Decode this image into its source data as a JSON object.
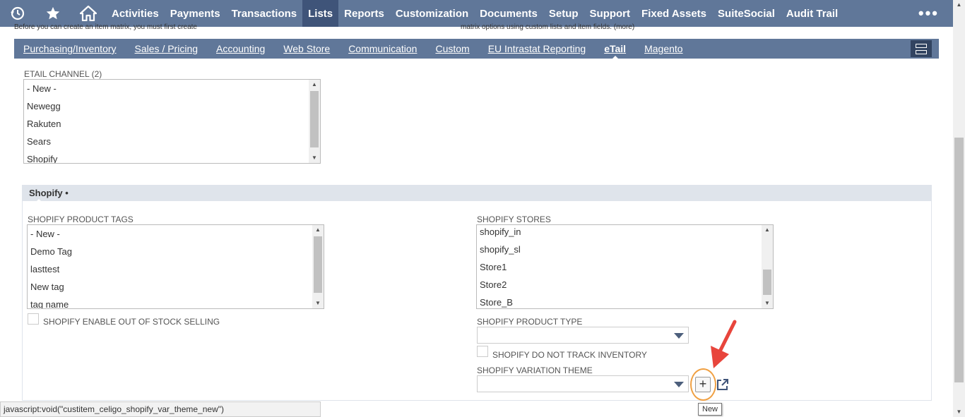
{
  "topnav": {
    "items": [
      {
        "label": "Activities"
      },
      {
        "label": "Payments"
      },
      {
        "label": "Transactions"
      },
      {
        "label": "Lists",
        "active": true
      },
      {
        "label": "Reports"
      },
      {
        "label": "Customization"
      },
      {
        "label": "Documents"
      },
      {
        "label": "Setup"
      },
      {
        "label": "Support"
      },
      {
        "label": "Fixed Assets"
      },
      {
        "label": "SuiteSocial"
      },
      {
        "label": "Audit Trail"
      }
    ],
    "more": "•••"
  },
  "cutoff": {
    "left": "Before you can create an item matrix, you must first create",
    "right": "matrix options using custom lists and item fields. (more)"
  },
  "subtabs": {
    "items": [
      {
        "label": "Purchasing/Inventory"
      },
      {
        "label": "Sales / Pricing"
      },
      {
        "label": "Accounting"
      },
      {
        "label": "Web Store"
      },
      {
        "label": "Communication"
      },
      {
        "label": "Custom"
      },
      {
        "label": "EU Intrastat Reporting"
      },
      {
        "label": "eTail",
        "active": true
      },
      {
        "label": "Magento"
      }
    ]
  },
  "etail_channel": {
    "label": "ETAIL CHANNEL (2)",
    "options": [
      "- New -",
      "Newegg",
      "Rakuten",
      "Sears",
      "Shopify"
    ]
  },
  "shopify_section": {
    "title": "Shopify •",
    "product_tags": {
      "label": "SHOPIFY PRODUCT TAGS",
      "options": [
        "- New -",
        "Demo Tag",
        "lasttest",
        "New tag",
        "tag name"
      ]
    },
    "stores": {
      "label": "SHOPIFY STORES",
      "options": [
        "shopify_in",
        "shopify_sl",
        "Store1",
        "Store2",
        "Store_B"
      ]
    },
    "enable_out_of_stock_label": "SHOPIFY ENABLE OUT OF STOCK SELLING",
    "product_type_label": "SHOPIFY PRODUCT TYPE",
    "do_not_track_label": "SHOPIFY DO NOT TRACK INVENTORY",
    "variation_theme_label": "SHOPIFY VARIATION THEME",
    "new_button": "+",
    "tooltip": "New"
  },
  "statusbar": "javascript:void(\"custitem_celigo_shopify_var_theme_new\")",
  "colors": {
    "nav": "#607799",
    "nav_active": "#3f5479",
    "section_header": "#dfe4eb",
    "highlight": "#f0a042",
    "arrow": "#e8453c"
  }
}
